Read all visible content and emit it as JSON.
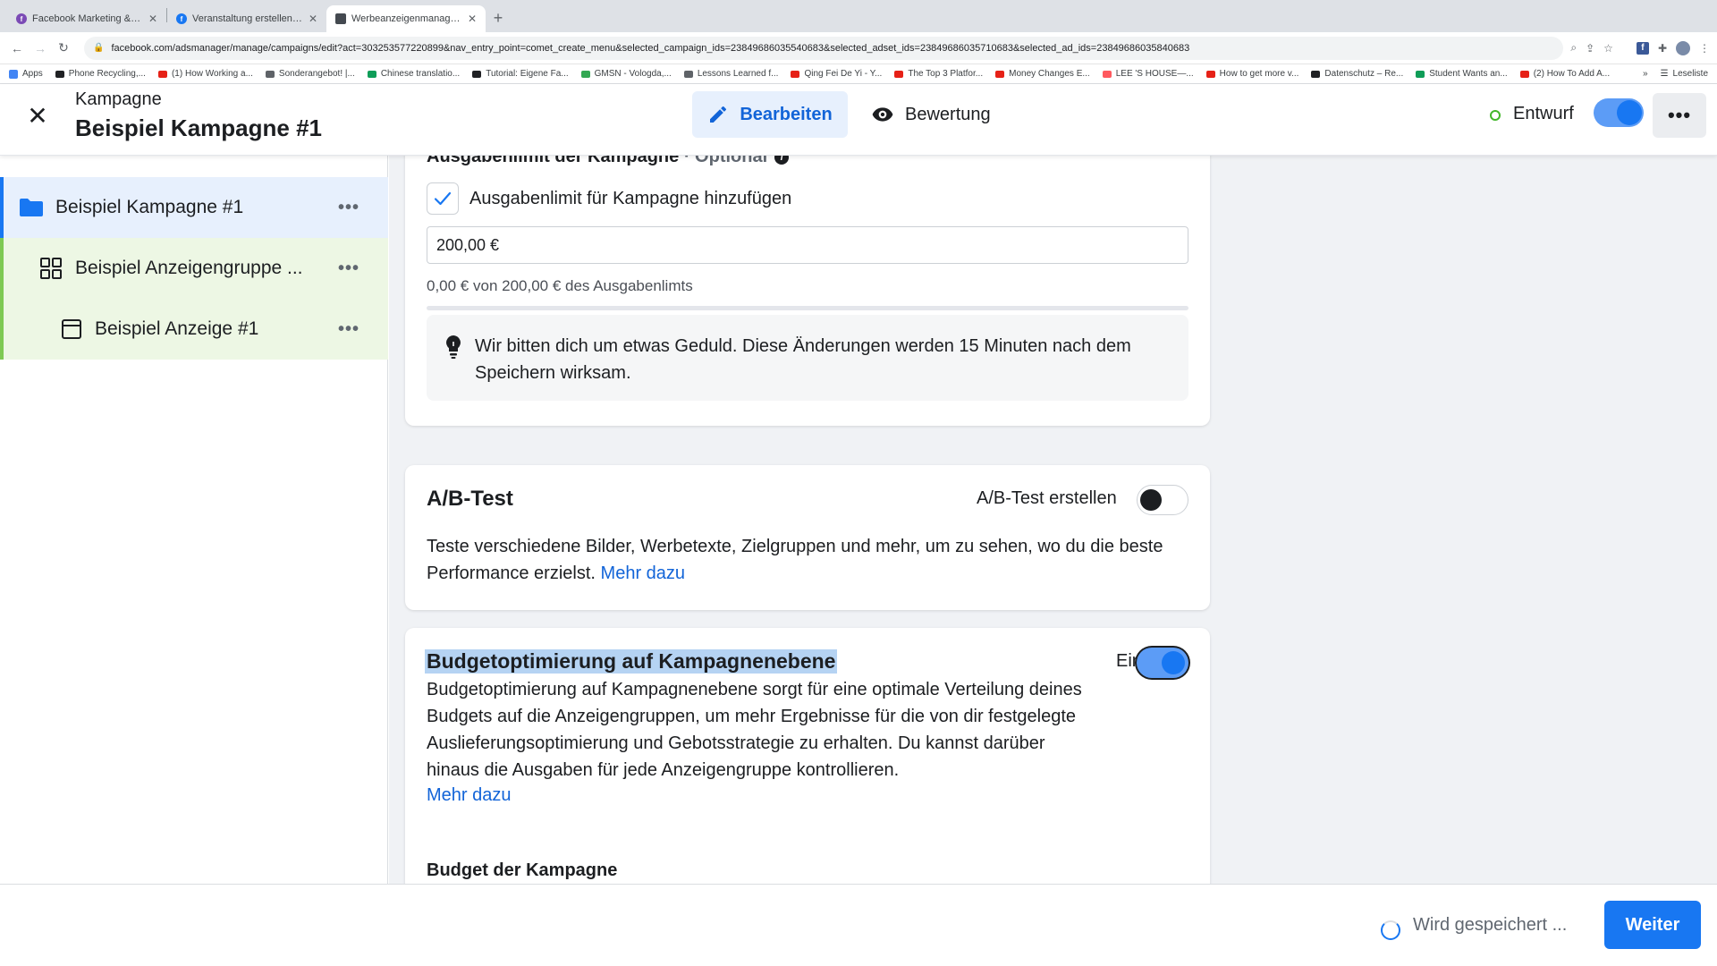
{
  "browser": {
    "tabs": [
      {
        "label": "Facebook Marketing & Werbea",
        "color": "#7b4ab5"
      },
      {
        "label": "Veranstaltung erstellen | Faceb",
        "color": "#1877f2"
      },
      {
        "label": "Werbeanzeigenmanager - Wer",
        "color": "#444950"
      }
    ],
    "url": "facebook.com/adsmanager/manage/campaigns/edit?act=303253577220899&nav_entry_point=comet_create_menu&selected_campaign_ids=23849686035540683&selected_adset_ids=23849686035710683&selected_ad_ids=23849686035840683",
    "bookmarks": [
      {
        "label": "Apps",
        "color": "#4285f4"
      },
      {
        "label": "Phone Recycling,...",
        "color": "#202124"
      },
      {
        "label": "(1) How Working a...",
        "color": "#e62117"
      },
      {
        "label": "Sonderangebot! |...",
        "color": "#5f6368"
      },
      {
        "label": "Chinese translatio...",
        "color": "#0f9d58"
      },
      {
        "label": "Tutorial: Eigene Fa...",
        "color": "#202124"
      },
      {
        "label": "GMSN - Vologda,...",
        "color": "#34a853"
      },
      {
        "label": "Lessons Learned f...",
        "color": "#5f6368"
      },
      {
        "label": "Qing Fei De Yi - Y...",
        "color": "#e62117"
      },
      {
        "label": "The Top 3 Platfor...",
        "color": "#e62117"
      },
      {
        "label": "Money Changes E...",
        "color": "#e62117"
      },
      {
        "label": "LEE 'S HOUSE—...",
        "color": "#ff5a5f"
      },
      {
        "label": "How to get more v...",
        "color": "#e62117"
      },
      {
        "label": "Datenschutz – Re...",
        "color": "#202124"
      },
      {
        "label": "Student Wants an...",
        "color": "#0f9d58"
      },
      {
        "label": "(2) How To Add A...",
        "color": "#e62117"
      }
    ],
    "bookmarks_more": "»",
    "reading_list": "Leseliste"
  },
  "header": {
    "small_label": "Kampagne",
    "title": "Beispiel Kampagne #1",
    "edit_label": "Bearbeiten",
    "review_label": "Bewertung",
    "status_label": "Entwurf",
    "more_label": "•••"
  },
  "sidebar": {
    "items": [
      {
        "label": "Beispiel Kampagne #1",
        "dots": "•••"
      },
      {
        "label": "Beispiel Anzeigengruppe ...",
        "dots": "•••"
      },
      {
        "label": "Beispiel Anzeige #1",
        "dots": "•••"
      }
    ]
  },
  "spend_limit": {
    "section_label": "Ausgabenlimit der Kampagne",
    "optional_label": " · Optional",
    "checkbox_label": "Ausgabenlimit für Kampagne hinzufügen",
    "checked": true,
    "amount_value": "200,00 €",
    "spent_text": "0,00 € von 200,00 € des Ausgabenlimts",
    "progress": 0,
    "notice_text": "Wir bitten dich um etwas Geduld. Diese Änderungen werden 15 Minuten nach dem Speichern wirksam."
  },
  "ab_test": {
    "title": "A/B-Test",
    "toggle_label": "A/B-Test erstellen",
    "toggle_on": false,
    "description": "Teste verschiedene Bilder, Werbetexte, Zielgruppen und mehr, um zu sehen, wo du die beste Performance erzielst.",
    "link": "Mehr dazu"
  },
  "cbo": {
    "title": "Budgetoptimierung auf Kampagnenebene",
    "toggle_label": "Ein",
    "toggle_on": true,
    "description": "Budgetoptimierung auf Kampagnenebene sorgt für eine optimale Verteilung deines Budgets auf die Anzeigengruppen, um mehr Ergebnisse für die von dir festgelegte Auslieferungsoptimierung und Gebotsstrategie zu erhalten. Du kannst darüber hinaus die Ausgaben für jede Anzeigengruppe kontrollieren.",
    "link": "Mehr dazu",
    "budget_label": "Budget der Kampagne"
  },
  "footer": {
    "saving_text": "Wird gespeichert ...",
    "next_label": "Weiter"
  },
  "colors": {
    "primary": "#1877f2",
    "link": "#1264d8",
    "draft_status": "#42b72a",
    "selection_highlight": "#b5d3f3"
  }
}
